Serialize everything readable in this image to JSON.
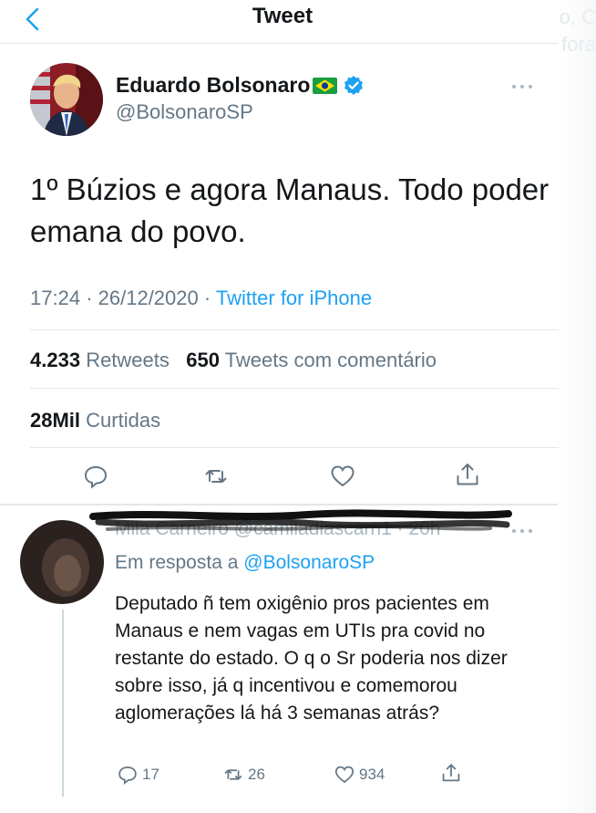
{
  "header": {
    "title": "Tweet",
    "ghost_text": "o, C fora"
  },
  "tweet": {
    "author_name": "Eduardo Bolsonaro",
    "flag_emoji": "brazil-flag-icon",
    "handle": "@BolsonaroSP",
    "text": "1º Búzios e agora Manaus. Todo poder emana do povo.",
    "time": "17:24",
    "date": "26/12/2020",
    "separator": "·",
    "source": "Twitter for iPhone",
    "retweets_count": "4.233",
    "retweets_label": "Retweets",
    "quotes_count": "650",
    "quotes_label": "Tweets com comentário",
    "likes_count": "28Mil",
    "likes_label": "Curtidas"
  },
  "reply": {
    "header_obscured": "Mila Carneiro @camiladiascarn1 · 20h",
    "reply_to_label": "Em resposta a",
    "reply_to_handle": "@BolsonaroSP",
    "text": "Deputado ñ tem oxigênio pros pacientes em Manaus e nem vagas em UTIs pra covid no restante do estado. O q o Sr poderia nos dizer sobre isso, já q incentivou e comemorou aglomerações lá há 3 semanas atrás?",
    "replies": "17",
    "retweets": "26",
    "likes": "934"
  },
  "colors": {
    "accent": "#1da1f2",
    "muted": "#657786",
    "text": "#14171a",
    "divider": "#e1e8ed"
  }
}
